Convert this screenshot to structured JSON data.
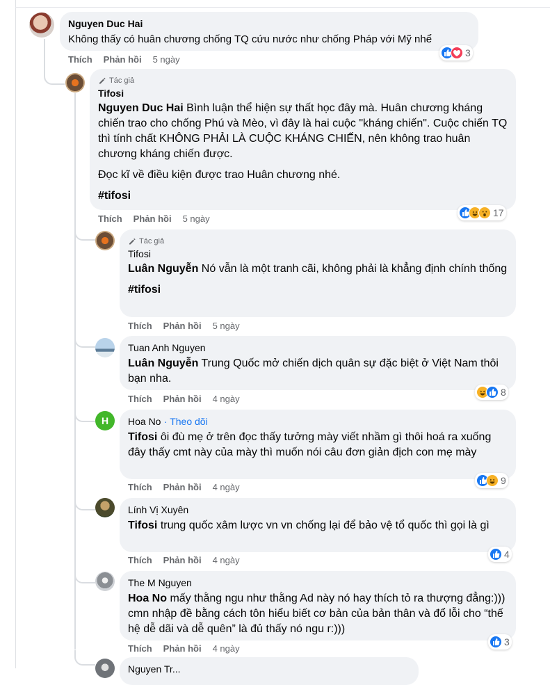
{
  "labels": {
    "like": "Thích",
    "reply": "Phản hồi",
    "author_badge": "Tác giả"
  },
  "comments": [
    {
      "author": "Nguyen Duc Hai",
      "text": "Không thấy có huân chương chống TQ cứu nước như chống Pháp với Mỹ nhể",
      "time": "5 ngày",
      "reactions": [
        "like-icon",
        "heart-icon"
      ],
      "count": "3"
    },
    {
      "author": "Tifosi",
      "badge": true,
      "mention": "Nguyen Duc Hai",
      "paragraphs": [
        "Bình luận thể hiện sự thất học đây mà. Huân chương kháng chiến trao cho chống Phú và Mèo, vì đây là hai cuộc \"kháng chiến\". Cuộc chiến TQ thì tính chất KHÔNG PHẢI LÀ CUỘC KHÁNG CHIẾN, nên không trao huân chương kháng chiến được.",
        "Đọc kĩ về điều kiện được trao Huân chương nhé.",
        "#tifosi"
      ],
      "time": "5 ngày",
      "reactions": [
        "like-icon",
        "haha-icon",
        "wow-icon"
      ],
      "count": "17"
    },
    {
      "author": "Tifosi",
      "badge": true,
      "mention": "Luân Nguyễn",
      "text": "Nó vẫn là một tranh cãi, không phải là khẳng định chính thống",
      "hashtag": "#tifosi",
      "time": "5 ngày"
    },
    {
      "author": "Tuan Anh Nguyen",
      "mention": "Luân Nguyễn",
      "text": "Trung Quốc mở chiến dịch quân sự đặc biệt ở Việt Nam thôi bạn nha.",
      "time": "4 ngày",
      "reactions": [
        "haha-icon",
        "like-icon"
      ],
      "count": "8"
    },
    {
      "author": "Hoa No",
      "follow": "· Theo dõi",
      "avatar_letter": "H",
      "mention": "Tifosi",
      "text": "ôi đù mẹ ở trên đọc thấy tưởng mày viết nhầm gì thôi hoá ra xuống đây thấy cmt này của mày thì muốn nói câu đơn giản địch con mẹ mày",
      "time": "4 ngày",
      "reactions": [
        "like-icon",
        "haha-icon"
      ],
      "count": "9"
    },
    {
      "author": "Lính Vị Xuyên",
      "mention": "Tifosi",
      "text": "trung quốc xâm lược vn vn chống lại để bảo vệ tổ quốc thì gọi là gì",
      "time": "4 ngày",
      "reactions": [
        "like-icon"
      ],
      "count": "4"
    },
    {
      "author": "The M Nguyen",
      "mention": "Hoa No",
      "text": "mấy thằng ngu như thằng Ad này nó hay thích tỏ ra thượng đẳng:))) cmn nhập đề bằng cách tôn hiểu biết cơ bản của bản thân và đổ lỗi cho “thế hệ dễ dãi và dễ quên” là đủ thấy nó ngu r:)))",
      "time": "4 ngày",
      "reactions": [
        "like-icon"
      ],
      "count": "3"
    },
    {
      "author": "Nguyen Tr..."
    }
  ]
}
